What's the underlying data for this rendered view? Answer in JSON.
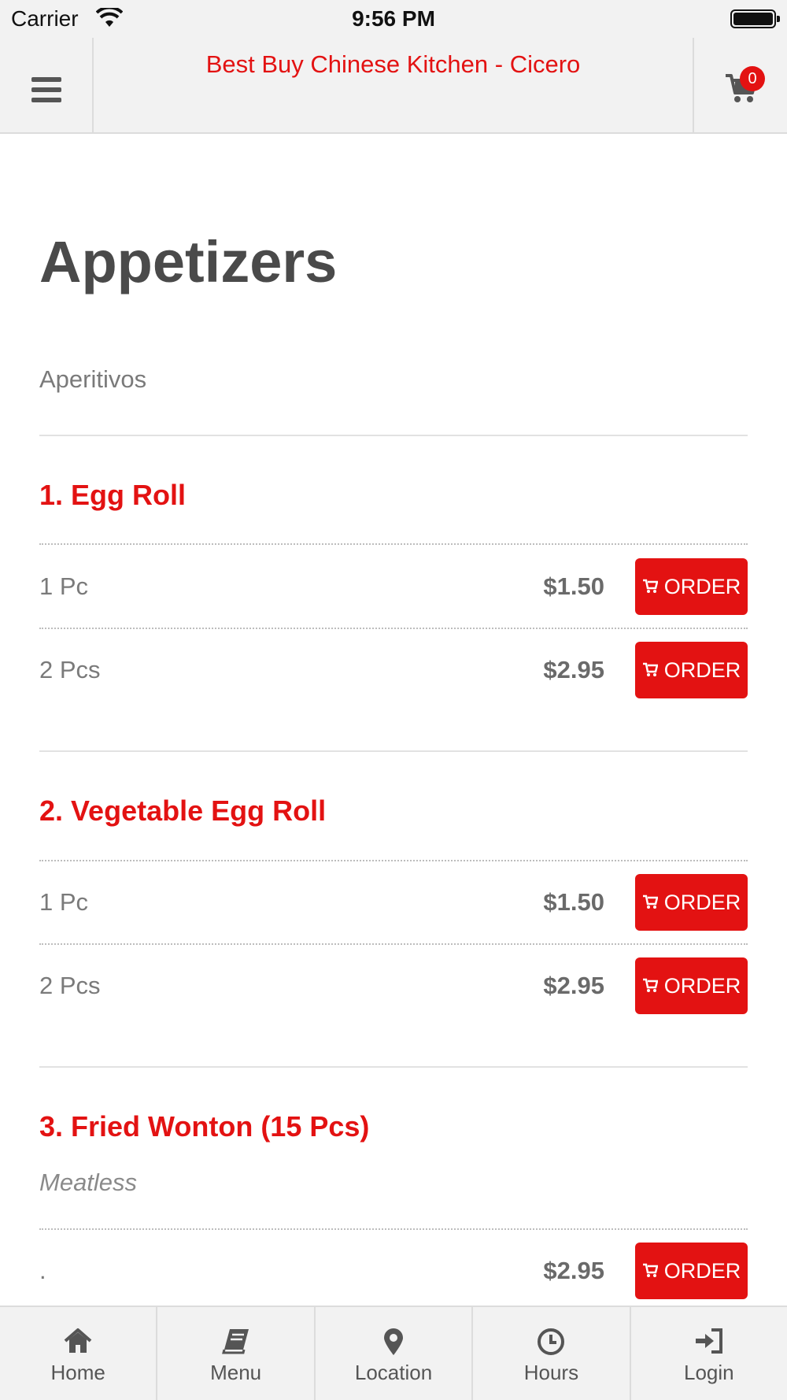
{
  "status_bar": {
    "carrier": "Carrier",
    "time": "9:56 PM"
  },
  "header": {
    "title": "Best Buy Chinese Kitchen - Cicero",
    "cart_count": "0"
  },
  "page": {
    "title": "Appetizers",
    "subtitle": "Aperitivos"
  },
  "items": [
    {
      "name": "1. Egg Roll",
      "note": "",
      "options": [
        {
          "size": "1 Pc",
          "price": "$1.50",
          "button": "ORDER"
        },
        {
          "size": "2 Pcs",
          "price": "$2.95",
          "button": "ORDER"
        }
      ]
    },
    {
      "name": "2. Vegetable Egg Roll",
      "note": "",
      "options": [
        {
          "size": "1 Pc",
          "price": "$1.50",
          "button": "ORDER"
        },
        {
          "size": "2 Pcs",
          "price": "$2.95",
          "button": "ORDER"
        }
      ]
    },
    {
      "name": "3. Fried Wonton (15 Pcs)",
      "note": "Meatless",
      "options": [
        {
          "size": ".",
          "price": "$2.95",
          "button": "ORDER"
        }
      ]
    }
  ],
  "tabs": [
    {
      "label": "Home",
      "icon": "home-icon"
    },
    {
      "label": "Menu",
      "icon": "book-icon"
    },
    {
      "label": "Location",
      "icon": "location-pin-icon"
    },
    {
      "label": "Hours",
      "icon": "clock-icon"
    },
    {
      "label": "Login",
      "icon": "login-icon"
    }
  ],
  "colors": {
    "accent": "#e31212",
    "bar_bg": "#f2f2f2",
    "text": "#555555"
  }
}
